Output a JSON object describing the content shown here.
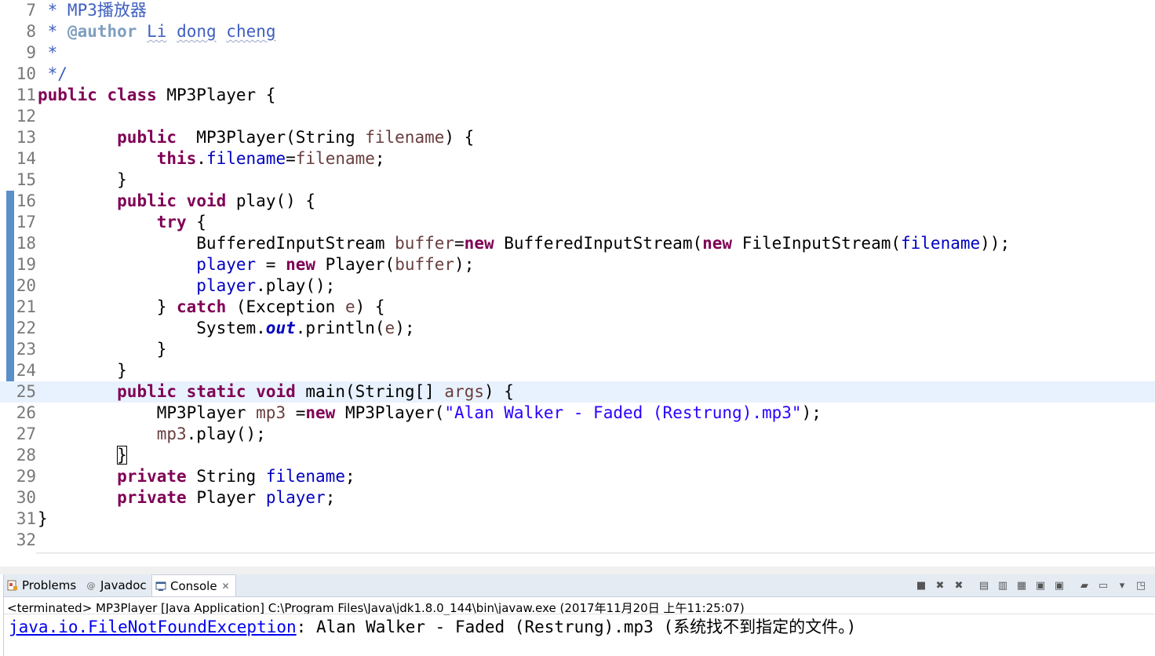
{
  "editor": {
    "lines": [
      {
        "n": "7",
        "parts": [
          {
            "t": " * MP3播放器",
            "c": "cm"
          }
        ]
      },
      {
        "n": "8",
        "parts": [
          {
            "t": " * ",
            "c": "cm"
          },
          {
            "t": "@author",
            "c": "tag"
          },
          {
            "t": " ",
            "c": "cm"
          },
          {
            "t": "Li",
            "c": "cm sq"
          },
          {
            "t": " ",
            "c": "cm"
          },
          {
            "t": "dong",
            "c": "cm sq"
          },
          {
            "t": " ",
            "c": "cm"
          },
          {
            "t": "cheng",
            "c": "cm sq"
          }
        ]
      },
      {
        "n": "9",
        "parts": [
          {
            "t": " *",
            "c": "cm"
          }
        ]
      },
      {
        "n": "10",
        "parts": [
          {
            "t": " */",
            "c": "cm"
          }
        ]
      },
      {
        "n": "11",
        "parts": [
          {
            "t": "public",
            "c": "kw"
          },
          {
            "t": " "
          },
          {
            "t": "class",
            "c": "kw"
          },
          {
            "t": " MP3Player {"
          }
        ]
      },
      {
        "n": "12",
        "parts": []
      },
      {
        "n": "13",
        "parts": [
          {
            "t": "        "
          },
          {
            "t": "public",
            "c": "kw"
          },
          {
            "t": "  MP3Player(String "
          },
          {
            "t": "filename",
            "c": "loc"
          },
          {
            "t": ") {"
          }
        ]
      },
      {
        "n": "14",
        "parts": [
          {
            "t": "            "
          },
          {
            "t": "this",
            "c": "kw"
          },
          {
            "t": "."
          },
          {
            "t": "filename",
            "c": "fld"
          },
          {
            "t": "="
          },
          {
            "t": "filename",
            "c": "loc"
          },
          {
            "t": ";"
          }
        ]
      },
      {
        "n": "15",
        "parts": [
          {
            "t": "        }"
          }
        ]
      },
      {
        "n": "16",
        "parts": [
          {
            "t": "        "
          },
          {
            "t": "public",
            "c": "kw"
          },
          {
            "t": " "
          },
          {
            "t": "void",
            "c": "kw"
          },
          {
            "t": " play() {"
          }
        ]
      },
      {
        "n": "17",
        "parts": [
          {
            "t": "            "
          },
          {
            "t": "try",
            "c": "kw"
          },
          {
            "t": " {"
          }
        ]
      },
      {
        "n": "18",
        "parts": [
          {
            "t": "                BufferedInputStream "
          },
          {
            "t": "buffer",
            "c": "loc"
          },
          {
            "t": "="
          },
          {
            "t": "new",
            "c": "kw"
          },
          {
            "t": " BufferedInputStream("
          },
          {
            "t": "new",
            "c": "kw"
          },
          {
            "t": " FileInputStream("
          },
          {
            "t": "filename",
            "c": "fld"
          },
          {
            "t": "));"
          }
        ]
      },
      {
        "n": "19",
        "parts": [
          {
            "t": "                "
          },
          {
            "t": "player",
            "c": "fld"
          },
          {
            "t": " = "
          },
          {
            "t": "new",
            "c": "kw"
          },
          {
            "t": " Player("
          },
          {
            "t": "buffer",
            "c": "loc"
          },
          {
            "t": ");"
          }
        ]
      },
      {
        "n": "20",
        "parts": [
          {
            "t": "                "
          },
          {
            "t": "player",
            "c": "fld"
          },
          {
            "t": ".play();"
          }
        ]
      },
      {
        "n": "21",
        "parts": [
          {
            "t": "            } "
          },
          {
            "t": "catch",
            "c": "kw"
          },
          {
            "t": " (Exception "
          },
          {
            "t": "e",
            "c": "loc"
          },
          {
            "t": ") {"
          }
        ]
      },
      {
        "n": "22",
        "parts": [
          {
            "t": "                System."
          },
          {
            "t": "out",
            "c": "stc"
          },
          {
            "t": ".println("
          },
          {
            "t": "e",
            "c": "loc"
          },
          {
            "t": ");"
          }
        ]
      },
      {
        "n": "23",
        "parts": [
          {
            "t": "            }"
          }
        ]
      },
      {
        "n": "24",
        "parts": [
          {
            "t": "        }"
          }
        ]
      },
      {
        "n": "25",
        "current": true,
        "parts": [
          {
            "t": "        "
          },
          {
            "t": "public",
            "c": "kw"
          },
          {
            "t": " "
          },
          {
            "t": "static",
            "c": "kw"
          },
          {
            "t": " "
          },
          {
            "t": "void",
            "c": "kw"
          },
          {
            "t": " main(String[] "
          },
          {
            "t": "args",
            "c": "loc"
          },
          {
            "t": ") {"
          }
        ]
      },
      {
        "n": "26",
        "parts": [
          {
            "t": "            MP3Player "
          },
          {
            "t": "mp3",
            "c": "loc"
          },
          {
            "t": " ="
          },
          {
            "t": "new",
            "c": "kw"
          },
          {
            "t": " MP3Player("
          },
          {
            "t": "\"Alan Walker - Faded (Restrung).mp3\"",
            "c": "str"
          },
          {
            "t": ");"
          }
        ]
      },
      {
        "n": "27",
        "parts": [
          {
            "t": "            "
          },
          {
            "t": "mp3",
            "c": "loc"
          },
          {
            "t": ".play();"
          }
        ]
      },
      {
        "n": "28",
        "parts": [
          {
            "t": "        "
          },
          {
            "t": "}",
            "c": "bracket-box"
          }
        ]
      },
      {
        "n": "29",
        "parts": [
          {
            "t": "        "
          },
          {
            "t": "private",
            "c": "kw"
          },
          {
            "t": " String "
          },
          {
            "t": "filename",
            "c": "fld"
          },
          {
            "t": ";"
          }
        ]
      },
      {
        "n": "30",
        "parts": [
          {
            "t": "        "
          },
          {
            "t": "private",
            "c": "kw"
          },
          {
            "t": " Player "
          },
          {
            "t": "player",
            "c": "fld"
          },
          {
            "t": ";"
          }
        ]
      },
      {
        "n": "31",
        "parts": [
          {
            "t": "}"
          }
        ]
      },
      {
        "n": "32",
        "parts": []
      }
    ]
  },
  "hscroll": {
    "left_arrow": "<"
  },
  "panel": {
    "tabs": {
      "problems": {
        "label": "Problems",
        "icon": "problems-icon"
      },
      "javadoc": {
        "label": "Javadoc",
        "icon": "at-icon"
      },
      "console": {
        "label": "Console",
        "icon": "console-icon",
        "close": "✕"
      }
    },
    "toolbar": [
      {
        "name": "terminate-icon",
        "glyph": "■"
      },
      {
        "name": "remove-launch-icon",
        "glyph": "✖"
      },
      {
        "name": "remove-all-terminated-icon",
        "glyph": "✖"
      },
      {
        "name": "clear-console-icon",
        "glyph": "▤"
      },
      {
        "name": "scroll-lock-icon",
        "glyph": "▥"
      },
      {
        "name": "word-wrap-icon",
        "glyph": "▦"
      },
      {
        "name": "show-console-on-output-icon",
        "glyph": "▣"
      },
      {
        "name": "show-console-on-error-icon",
        "glyph": "▣"
      },
      {
        "name": "pin-console-icon",
        "glyph": "▰"
      },
      {
        "name": "display-selected-console-icon",
        "glyph": "▭"
      },
      {
        "name": "dropdown-chevron-icon",
        "glyph": "▾"
      },
      {
        "name": "open-console-icon",
        "glyph": "◳"
      }
    ],
    "status": "<terminated> MP3Player [Java Application] C:\\Program Files\\Java\\jdk1.8.0_144\\bin\\javaw.exe (2017年11月20日 上午11:25:07)",
    "output": {
      "exception_link": "java.io.FileNotFoundException",
      "message": ": Alan Walker - Faded (Restrung).mp3 (系统找不到指定的文件。)"
    }
  },
  "colors": {
    "keyword": "#7f0055",
    "field": "#0000c0",
    "string": "#2a00ff",
    "comment": "#3f5fbf",
    "current_line": "#e8f2fe",
    "change_bar": "#5a8fc8"
  }
}
